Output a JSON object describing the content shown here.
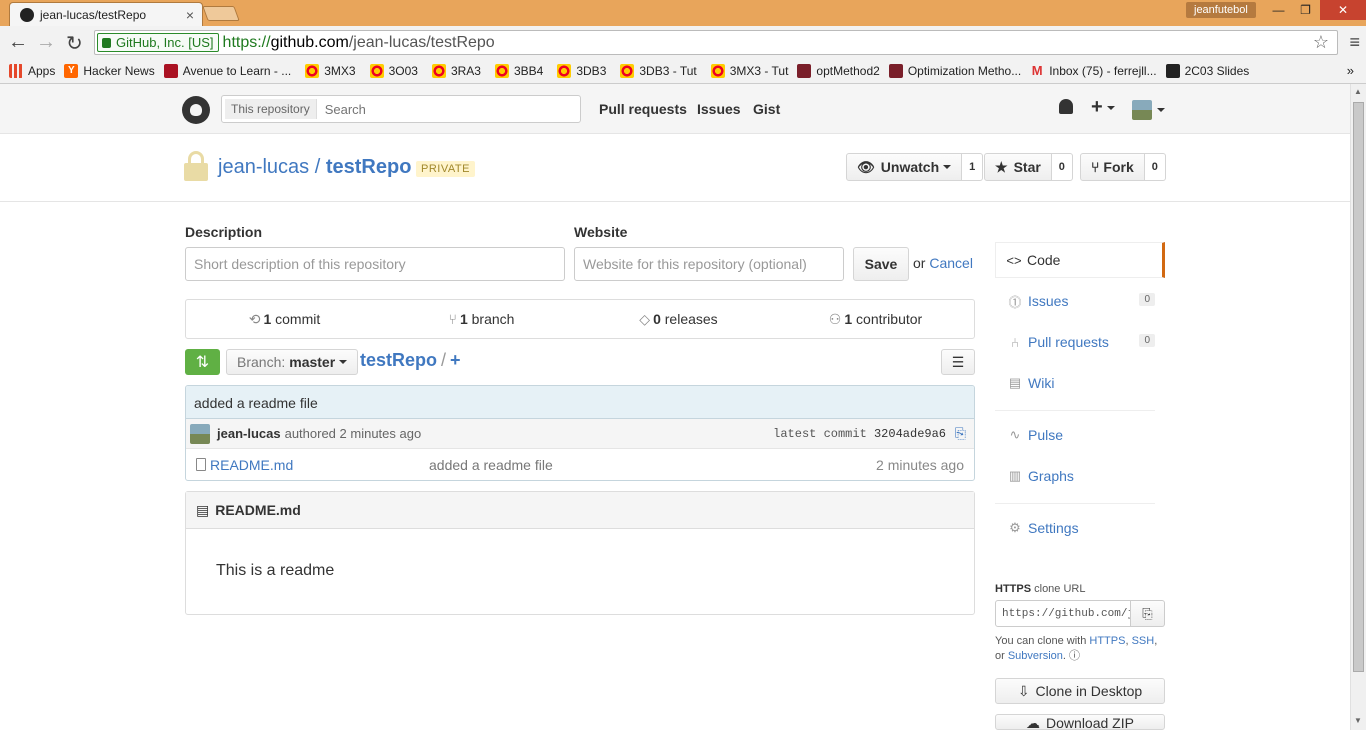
{
  "browser": {
    "tab_title": "jean-lucas/testRepo",
    "tab_close": "×",
    "user_label": "jeanfutebol",
    "window_buttons": {
      "minimize": "—",
      "restore": "❐",
      "close": "✕"
    },
    "ev_label": "GitHub, Inc. [US]",
    "url_scheme": "https://",
    "url_host": "github.com",
    "url_path": "/jean-lucas/testRepo",
    "bookmarks": [
      {
        "label": "Apps",
        "icon": "apps-icon"
      },
      {
        "label": "Hacker News",
        "icon": "hacker-news-icon"
      },
      {
        "label": "Avenue to Learn - ...",
        "icon": "avenue-icon"
      },
      {
        "label": "3MX3",
        "icon": "mcmaster-icon"
      },
      {
        "label": "3O03",
        "icon": "mcmaster-icon"
      },
      {
        "label": "3RA3",
        "icon": "mcmaster-icon"
      },
      {
        "label": "3BB4",
        "icon": "mcmaster-icon"
      },
      {
        "label": "3DB3",
        "icon": "mcmaster-icon"
      },
      {
        "label": "3DB3 - Tut",
        "icon": "mcmaster-icon"
      },
      {
        "label": "3MX3 - Tut",
        "icon": "mcmaster-icon"
      },
      {
        "label": "optMethod2",
        "icon": "mit-icon"
      },
      {
        "label": "Optimization Metho...",
        "icon": "mit-icon"
      },
      {
        "label": "Inbox (75) - ferrejll...",
        "icon": "gmail-icon"
      },
      {
        "label": "2C03 Slides",
        "icon": "princeton-icon"
      }
    ],
    "bookmarks_more": "»"
  },
  "header": {
    "search_scope": "This repository",
    "search_placeholder": "Search",
    "nav": [
      "Pull requests",
      "Issues",
      "Gist"
    ],
    "plus": "+"
  },
  "repo": {
    "owner": "jean-lucas",
    "separator": "/",
    "name": "testRepo",
    "badge": "PRIVATE",
    "unwatch_label": "Unwatch",
    "unwatch_count": "1",
    "star_label": "Star",
    "star_count": "0",
    "fork_label": "Fork",
    "fork_count": "0"
  },
  "edit": {
    "description_label": "Description",
    "description_placeholder": "Short description of this repository",
    "website_label": "Website",
    "website_placeholder": "Website for this repository (optional)",
    "save_label": "Save",
    "or_text": "or",
    "cancel_label": "Cancel"
  },
  "stats": [
    {
      "count": "1",
      "label": "commit",
      "icon": "history-icon"
    },
    {
      "count": "1",
      "label": "branch",
      "icon": "branch-icon"
    },
    {
      "count": "0",
      "label": "releases",
      "icon": "tag-icon"
    },
    {
      "count": "1",
      "label": "contributor",
      "icon": "organization-icon"
    }
  ],
  "filenav": {
    "branch_prefix": "Branch:",
    "branch_name": "master",
    "crumb_repo": "testRepo",
    "crumb_sep": "/",
    "crumb_add": "+"
  },
  "commit": {
    "message": "added a readme file",
    "author": "jean-lucas",
    "authored": "authored 2 minutes ago",
    "latest_label": "latest commit",
    "sha": "3204ade9a6"
  },
  "files": [
    {
      "name": "README.md",
      "message": "added a readme file",
      "age": "2 minutes ago"
    }
  ],
  "readme": {
    "title": "README.md",
    "body": "This is a readme"
  },
  "sidebar": {
    "items": [
      {
        "label": "Code",
        "icon": "code-icon",
        "count": ""
      },
      {
        "label": "Issues",
        "icon": "issue-icon",
        "count": "0"
      },
      {
        "label": "Pull requests",
        "icon": "pull-request-icon",
        "count": "0"
      },
      {
        "label": "Wiki",
        "icon": "book-icon",
        "count": ""
      },
      {
        "label": "Pulse",
        "icon": "pulse-icon",
        "count": ""
      },
      {
        "label": "Graphs",
        "icon": "graph-icon",
        "count": ""
      },
      {
        "label": "Settings",
        "icon": "gear-icon",
        "count": ""
      }
    ],
    "clone_protocol": "HTTPS",
    "clone_label": "clone URL",
    "clone_url": "https://github.com/jean-lucas/testRepo.git",
    "help_prefix": "You can clone with",
    "help_https": "HTTPS",
    "help_ssh": "SSH",
    "help_or": "or",
    "help_subversion": "Subversion",
    "clone_desktop": "Clone in Desktop",
    "download_zip": "Download ZIP"
  }
}
